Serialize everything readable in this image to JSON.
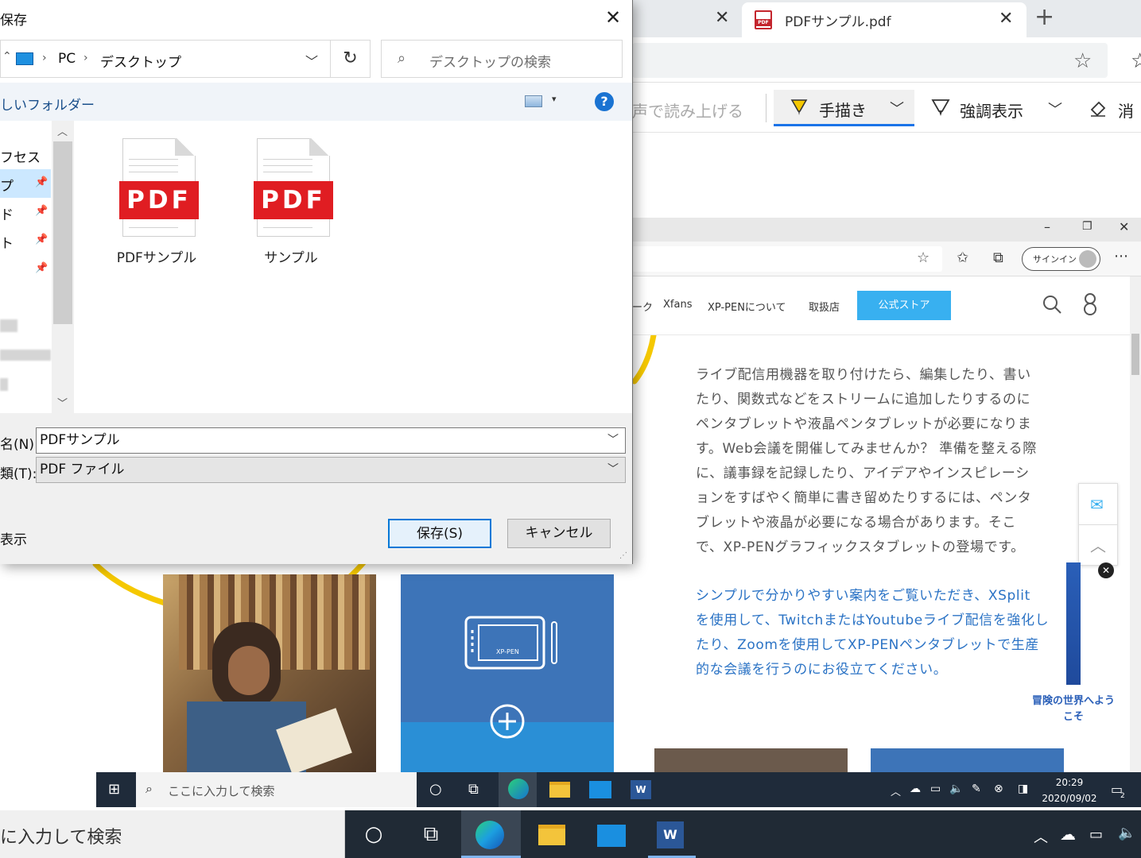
{
  "edge": {
    "tab_active_title": "PDFサンプル.pdf",
    "new_tab_glyph": "+",
    "toolbar": {
      "read_aloud": "声で読み上げる",
      "draw": "手描き",
      "highlight": "強調表示",
      "erase": "消"
    }
  },
  "dialog": {
    "title": "保存",
    "breadcrumb": [
      "PC",
      "デスクトップ"
    ],
    "search_placeholder": "デスクトップの検索",
    "new_folder": "しいフォルダー",
    "nav_items": [
      "フセス",
      "プ",
      "ド",
      "ト"
    ],
    "files": [
      {
        "name": "PDFサンプル",
        "badge": "PDF"
      },
      {
        "name": "サンプル",
        "badge": "PDF"
      }
    ],
    "filename_label": "名(N):",
    "filename_value": "PDFサンプル",
    "filetype_label": "類(T):",
    "filetype_value": "PDF ファイル",
    "hide_folders": "表示",
    "save_button": "保存(S)",
    "cancel_button": "キャンセル"
  },
  "inner_browser": {
    "signin": "サインイン",
    "nav": [
      "ーク",
      "Xfans",
      "XP-PENについて",
      "取扱店"
    ],
    "store_button": "公式ストア",
    "paragraph1_lines": [
      "ライブ配信用機器を取り付けたら、編集したり、書い",
      "たり、関数式などをストリームに追加したりするのに",
      "ペンタブレットや液晶ペンタブレットが必要になりま",
      "す。Web会議を開催してみませんか？ 準備を整える際",
      "に、議事録を記録したり、アイデアやインスピレーシ",
      "ョンをすばやく簡単に書き留めたりするには、ペンタ",
      "ブレットや液晶が必要になる場合があります。そこ",
      "で、XP-PENグラフィックスタブレットの登場です。"
    ],
    "paragraph2_lines": [
      "シンプルで分かりやすい案内をご覧いただき、XSplit",
      "を使用して、TwitchまたはYoutubeライブ配信を強化し",
      "たり、Zoomを使用してXP-PENペンタブレットで生産",
      "的な会議を行うのにお役立てください。"
    ],
    "ad_text": "冒険の世界へようこそ",
    "tablet_brand": "XP-PEN",
    "taskbar_search": "ここに入力して検索",
    "clock_time": "20:29",
    "clock_date": "2020/09/02",
    "notification_count": "2"
  },
  "taskbar": {
    "search_text": "に入力して検索"
  },
  "colors": {
    "accent": "#0078d7",
    "pdf_red": "#e01d22",
    "store_blue": "#38b0f0",
    "link_blue": "#2b73c5",
    "highlight_yellow": "#f5c800"
  }
}
